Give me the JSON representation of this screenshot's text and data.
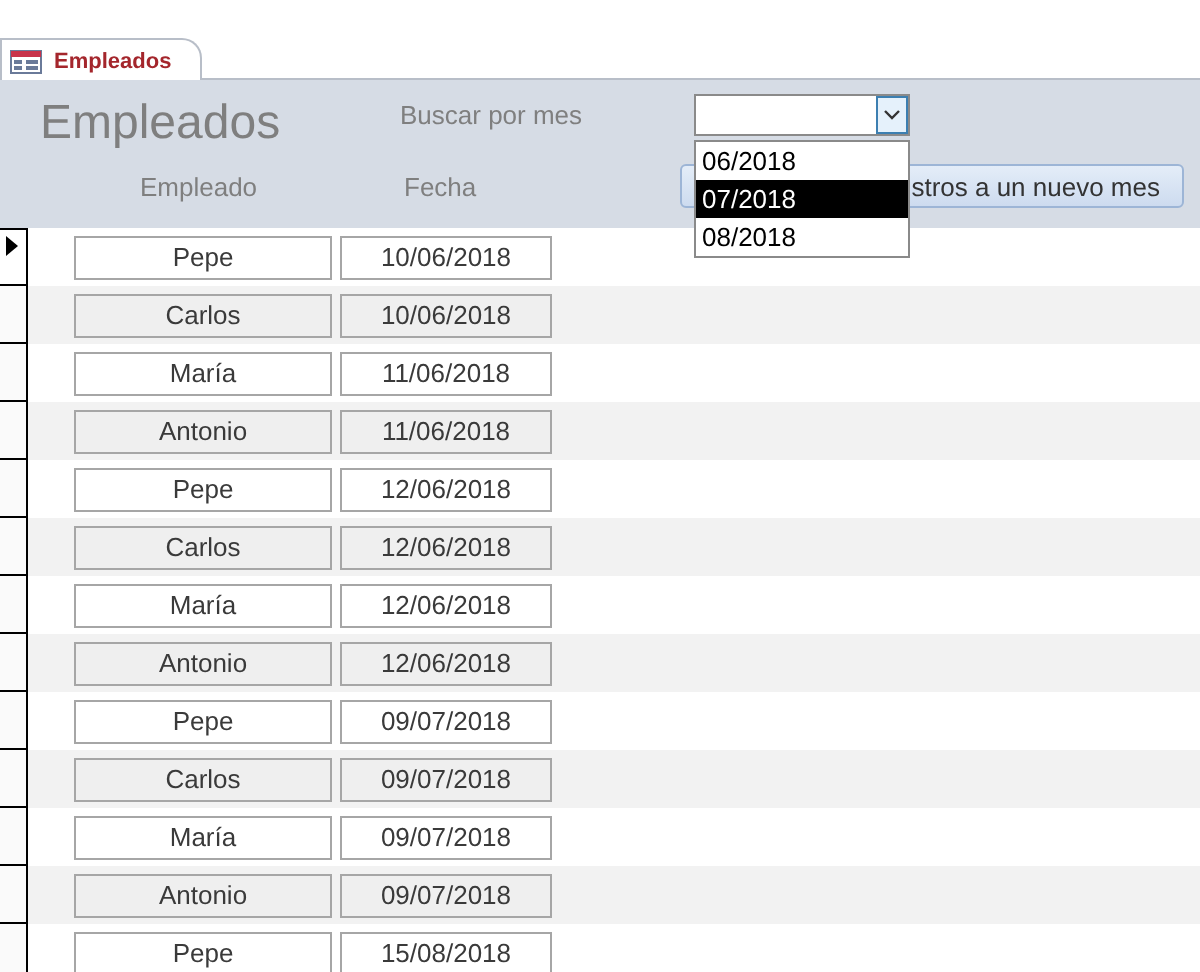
{
  "tabs": [
    {
      "label": "Empleados",
      "selected": true
    }
  ],
  "form": {
    "title": "Empleados",
    "search_label": "Buscar por mes",
    "combo": {
      "expanded": true,
      "options": [
        {
          "label": "06/2018",
          "selected": false
        },
        {
          "label": "07/2018",
          "selected": true
        },
        {
          "label": "08/2018",
          "selected": false
        }
      ]
    },
    "button": "stros a un nuevo mes",
    "columns": [
      "Empleado",
      "Fecha"
    ]
  },
  "records": [
    {
      "empleado": "Pepe",
      "fecha": "10/06/2018",
      "selected": true
    },
    {
      "empleado": "Carlos",
      "fecha": "10/06/2018",
      "selected": false
    },
    {
      "empleado": "María",
      "fecha": "11/06/2018",
      "selected": false
    },
    {
      "empleado": "Antonio",
      "fecha": "11/06/2018",
      "selected": false
    },
    {
      "empleado": "Pepe",
      "fecha": "12/06/2018",
      "selected": false
    },
    {
      "empleado": "Carlos",
      "fecha": "12/06/2018",
      "selected": false
    },
    {
      "empleado": "María",
      "fecha": "12/06/2018",
      "selected": false
    },
    {
      "empleado": "Antonio",
      "fecha": "12/06/2018",
      "selected": false
    },
    {
      "empleado": "Pepe",
      "fecha": "09/07/2018",
      "selected": false
    },
    {
      "empleado": "Carlos",
      "fecha": "09/07/2018",
      "selected": false
    },
    {
      "empleado": "María",
      "fecha": "09/07/2018",
      "selected": false
    },
    {
      "empleado": "Antonio",
      "fecha": "09/07/2018",
      "selected": false
    },
    {
      "empleado": "Pepe",
      "fecha": "15/08/2018",
      "selected": false
    }
  ]
}
